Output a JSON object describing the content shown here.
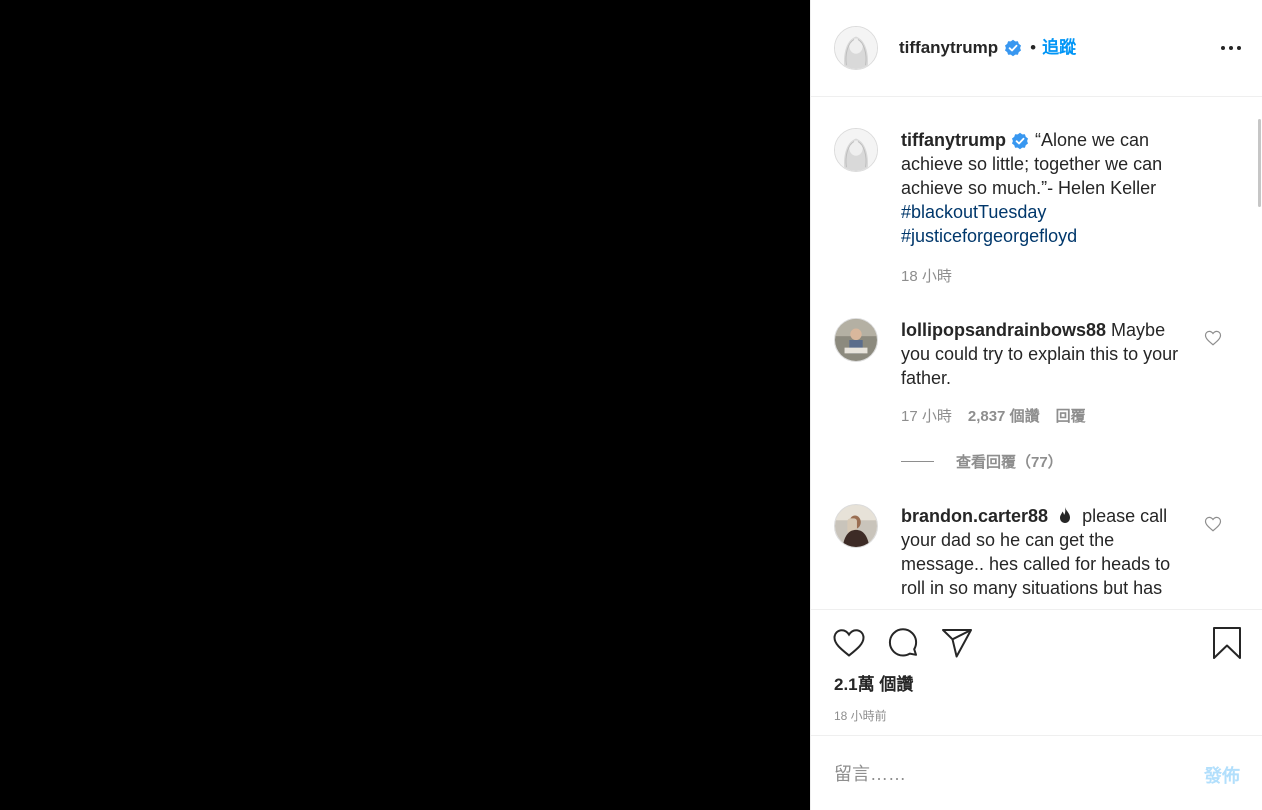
{
  "post": {
    "username": "tiffanytrump",
    "follow_label": "追蹤",
    "caption": {
      "text": "“Alone we can achieve so little; together we can achieve so much.”- Helen Keller",
      "hashtags": [
        "#blackoutTuesday",
        "#justiceforgeorgefloyd"
      ],
      "time": "18 小時"
    },
    "comments": [
      {
        "username": "lollipopsandrainbows88",
        "text": "Maybe you could try to explain this to your father.",
        "time": "17 小時",
        "likes": "2,837 個讚",
        "reply_label": "回覆",
        "view_replies": "查看回覆（77）"
      },
      {
        "username": "brandon.carter88",
        "text": "please call your dad so he can get the message.. hes called for heads to roll in so many situations but has"
      }
    ],
    "like_count": "2.1萬 個讚",
    "time_ago": "18 小時前",
    "comment_placeholder": "留言……",
    "post_label": "發佈"
  },
  "icons": {
    "verified": "verified-badge-icon",
    "more": "more-options-icon",
    "heart": "heart-icon",
    "comment": "comment-icon",
    "share": "share-icon",
    "save": "bookmark-icon",
    "flame": "flame-emoji-icon"
  },
  "colors": {
    "link_blue": "#0095f6",
    "hashtag_blue": "#00376b",
    "muted": "#8e8e8e",
    "post_disabled": "#b2dffc"
  }
}
